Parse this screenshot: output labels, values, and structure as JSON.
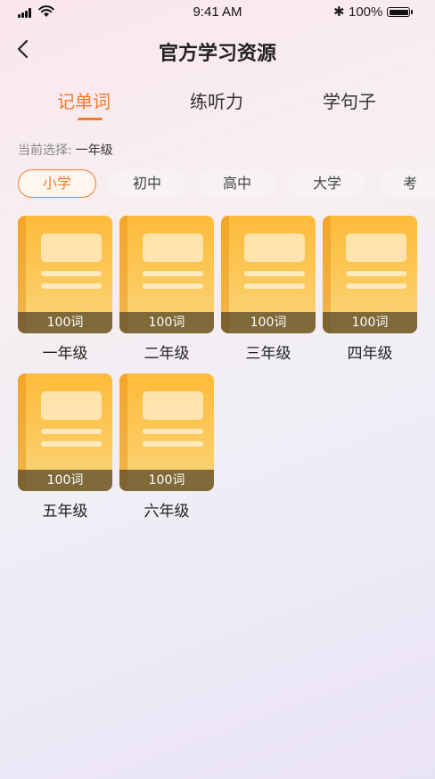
{
  "status_bar": {
    "time": "9:41 AM",
    "battery": "100%"
  },
  "header": {
    "title": "官方学习资源",
    "back_icon": "chevron-left-icon"
  },
  "tabs": [
    {
      "label": "记单词",
      "active": true
    },
    {
      "label": "练听力",
      "active": false
    },
    {
      "label": "学句子",
      "active": false
    }
  ],
  "selection": {
    "label": "当前选择:",
    "value": "一年级"
  },
  "filters": [
    {
      "label": "小学",
      "active": true
    },
    {
      "label": "初中",
      "active": false
    },
    {
      "label": "高中",
      "active": false
    },
    {
      "label": "大学",
      "active": false
    },
    {
      "label": "考",
      "active": false
    }
  ],
  "books": [
    {
      "count": "100词",
      "name": "一年级"
    },
    {
      "count": "100词",
      "name": "二年级"
    },
    {
      "count": "100词",
      "name": "三年级"
    },
    {
      "count": "100词",
      "name": "四年级"
    },
    {
      "count": "100词",
      "name": "五年级"
    },
    {
      "count": "100词",
      "name": "六年级"
    }
  ],
  "colors": {
    "accent": "#f07a2c",
    "book": "#fcc654",
    "book_footer": "#64522c"
  }
}
